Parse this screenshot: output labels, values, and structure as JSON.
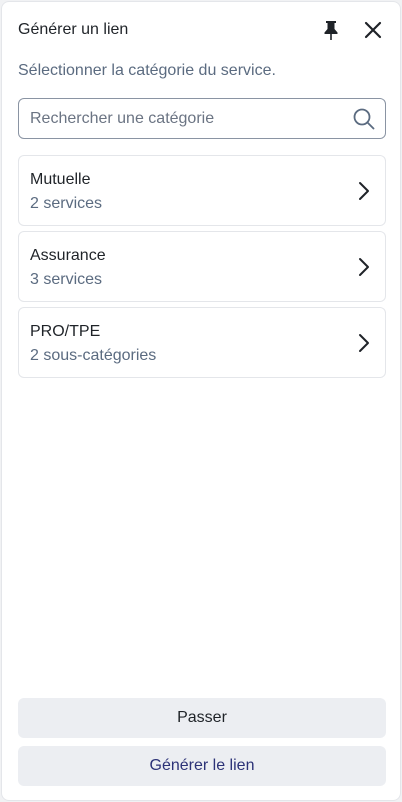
{
  "header": {
    "title": "Générer un lien",
    "pin_icon": "pin-icon",
    "close_icon": "close-icon"
  },
  "subtitle": "Sélectionner la catégorie du service.",
  "search": {
    "placeholder": "Rechercher une catégorie",
    "value": "",
    "icon": "search-icon"
  },
  "categories": [
    {
      "name": "Mutuelle",
      "count": "2 services"
    },
    {
      "name": "Assurance",
      "count": "3 services"
    },
    {
      "name": "PRO/TPE",
      "count": "2 sous-catégories"
    }
  ],
  "footer": {
    "skip_label": "Passer",
    "generate_label": "Générer le lien"
  },
  "colors": {
    "muted_text": "#5b6b80",
    "button_bg": "#eceef2",
    "primary_text": "#2c3277",
    "border": "#e4e6ea"
  }
}
